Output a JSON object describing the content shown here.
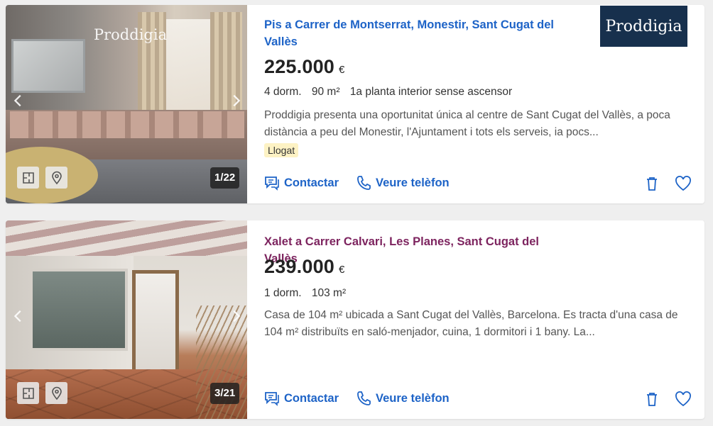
{
  "listings": [
    {
      "title": "Pis a Carrer de Montserrat, Monestir, Sant Cugat del Vallès",
      "price": "225.000",
      "currency": "€",
      "details": [
        "4 dorm.",
        "90 m²",
        "1a planta interior sense ascensor"
      ],
      "description": "Proddigia presenta una oportunitat única al centre de Sant Cugat del Vallès, a poca distància a peu del Monestir, l'Ajuntament i tots els serveis, ia pocs...",
      "badge": "Llogat",
      "photo_counter": "1/22",
      "photo_watermark": "Proddigia",
      "agency_logo": "Proddigia",
      "contact_label": "Contactar",
      "phone_label": "Veure telèfon",
      "title_color": "#1d63c7"
    },
    {
      "title": "Xalet a Carrer Calvari, Les Planes, Sant Cugat del Vallès",
      "price": "239.000",
      "currency": "€",
      "details": [
        "1 dorm.",
        "103 m²"
      ],
      "description": "Casa de 104 m² ubicada a Sant Cugat del Vallès, Barcelona. Es tracta d'una casa de 104 m² distribuïts en saló-menjador, cuina, 1 dormitori i 1 bany. La...",
      "photo_counter": "3/21",
      "contact_label": "Contactar",
      "phone_label": "Veure telèfon",
      "title_color": "#7d245f"
    }
  ],
  "icons": {
    "prev": "chevron-left-icon",
    "next": "chevron-right-icon",
    "floorplan": "floorplan-icon",
    "map": "map-pin-icon",
    "contact": "chat-icon",
    "phone": "phone-icon",
    "discard": "trash-icon",
    "favorite": "heart-icon"
  },
  "colors": {
    "link": "#1d63c7",
    "visited": "#7d245f",
    "badge_bg": "#fdf2c4",
    "logo_bg": "#17304d"
  }
}
